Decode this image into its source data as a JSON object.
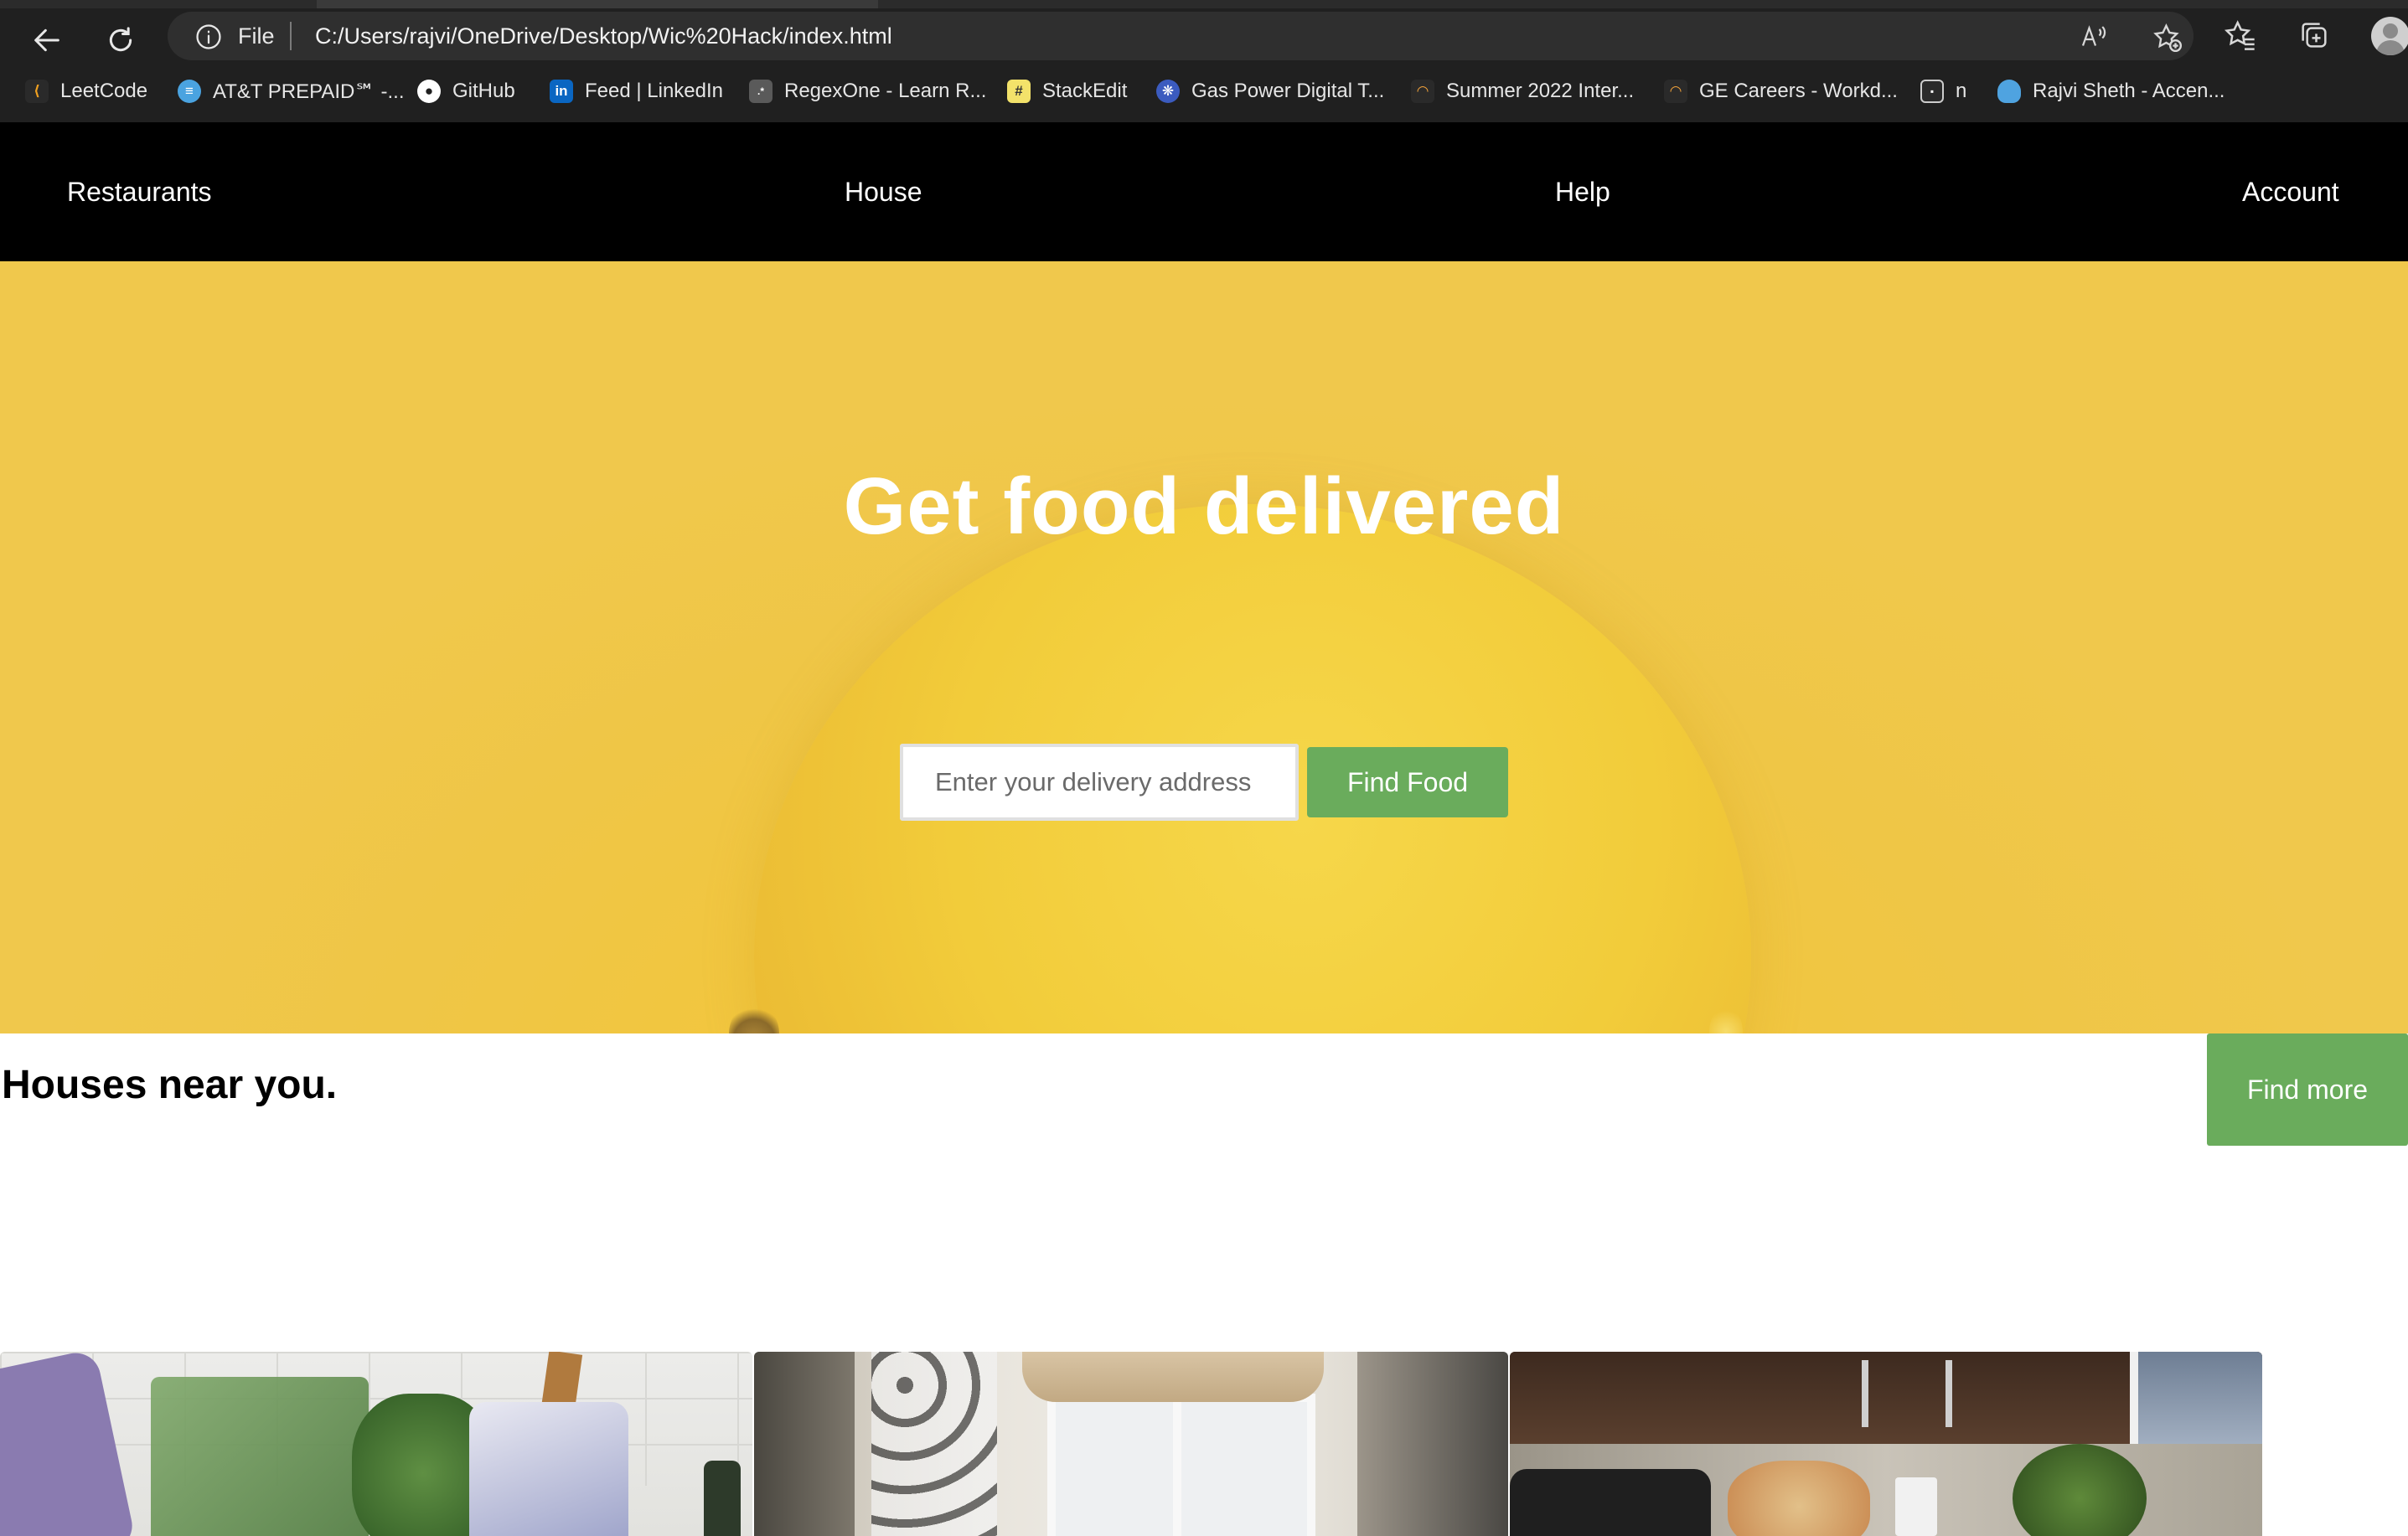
{
  "browser": {
    "address": {
      "scheme": "File",
      "url": "C:/Users/rajvi/OneDrive/Desktop/Wic%20Hack/index.html"
    },
    "icons": [
      "back-arrow-icon",
      "refresh-icon",
      "info-icon",
      "read-aloud-icon",
      "add-favorite-icon",
      "favorites-icon",
      "collections-icon",
      "profile-icon"
    ],
    "bookmarks": [
      {
        "label": "LeetCode",
        "icon": "leetcode-icon",
        "color": "#f0a020"
      },
      {
        "label": "AT&T PREPAID℠ -...",
        "icon": "att-icon",
        "color": "#4aa3e0"
      },
      {
        "label": "GitHub",
        "icon": "github-icon",
        "color": "#ffffff"
      },
      {
        "label": "Feed | LinkedIn",
        "icon": "linkedin-icon",
        "color": "#0a66c2"
      },
      {
        "label": "RegexOne - Learn R...",
        "icon": "regexone-icon",
        "color": "#888888"
      },
      {
        "label": "StackEdit",
        "icon": "stackedit-icon",
        "color": "#f3e26a"
      },
      {
        "label": "Gas Power Digital T...",
        "icon": "ge-icon",
        "color": "#3b5bbf"
      },
      {
        "label": "Summer 2022 Inter...",
        "icon": "workday-icon",
        "color": "#f2a23a"
      },
      {
        "label": "GE Careers - Workd...",
        "icon": "workday-icon",
        "color": "#f2a23a"
      },
      {
        "label": "n",
        "icon": "calendar-icon",
        "color": "#cccccc"
      },
      {
        "label": "Rajvi Sheth - Accen...",
        "icon": "salesforce-cloud-icon",
        "color": "#4fa3e0"
      }
    ]
  },
  "nav": {
    "items": [
      "Restaurants",
      "House",
      "Help",
      "Account"
    ]
  },
  "hero": {
    "title": "Get food delivered",
    "address_placeholder": "Enter your delivery address",
    "button": "Find Food"
  },
  "houses": {
    "title": "Houses near you.",
    "button": "Find more"
  },
  "colors": {
    "accent_green": "#6aac5c",
    "hero_yellow": "#f2c63e",
    "nav_black": "#000000"
  }
}
